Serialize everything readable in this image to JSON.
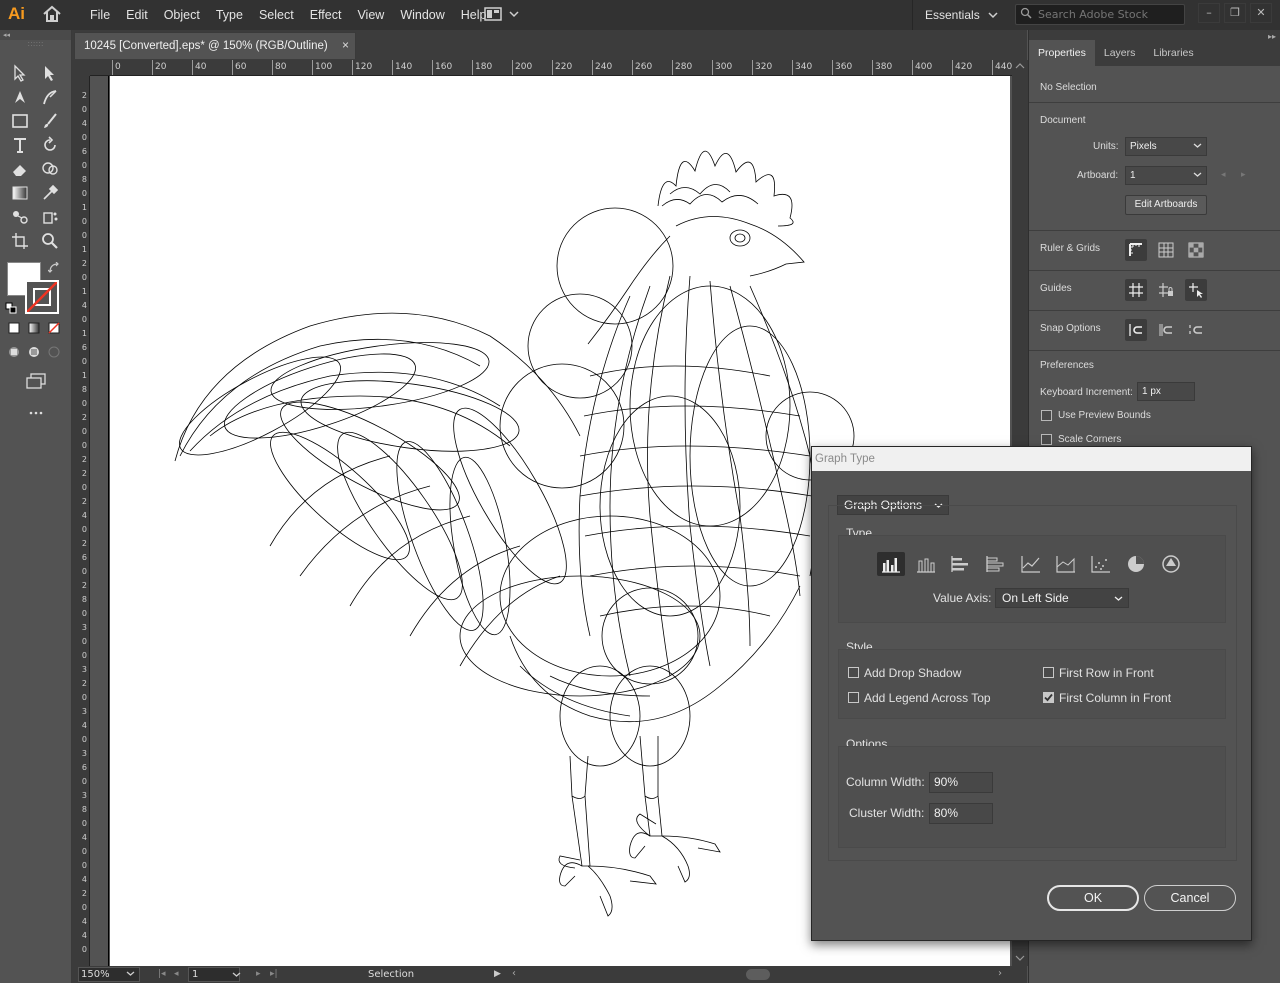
{
  "app": {
    "logo": "Ai",
    "workspace": "Essentials"
  },
  "menu": [
    "File",
    "Edit",
    "Object",
    "Type",
    "Select",
    "Effect",
    "View",
    "Window",
    "Help"
  ],
  "search": {
    "placeholder": "Search Adobe Stock"
  },
  "document": {
    "tab_title": "10245 [Converted].eps* @ 150% (RGB/Outline)",
    "close": "×"
  },
  "ruler": {
    "h_ticks": [
      "0",
      "20",
      "40",
      "60",
      "80",
      "100",
      "120",
      "140",
      "160",
      "180",
      "200",
      "220",
      "240",
      "260",
      "280",
      "300",
      "320",
      "340",
      "360",
      "380",
      "400",
      "420",
      "440"
    ],
    "v_ticks": [
      "2",
      "0",
      "4",
      "0",
      "6",
      "0",
      "8",
      "0",
      "1",
      "0",
      "0",
      "1",
      "2",
      "0",
      "1",
      "4",
      "0",
      "1",
      "6",
      "0",
      "1",
      "8",
      "0",
      "2",
      "0",
      "0",
      "2",
      "2",
      "0",
      "2",
      "4",
      "0",
      "2",
      "6",
      "0",
      "2",
      "8",
      "0",
      "3",
      "0",
      "0",
      "3",
      "2",
      "0",
      "3",
      "4",
      "0",
      "3",
      "6",
      "0",
      "3",
      "8",
      "0",
      "4",
      "0",
      "0",
      "4",
      "2",
      "0",
      "4",
      "4",
      "0"
    ]
  },
  "status": {
    "zoom": "150%",
    "page": "1",
    "tool": "Selection"
  },
  "panel": {
    "tabs": [
      "Properties",
      "Layers",
      "Libraries"
    ],
    "selection": "No Selection",
    "document_title": "Document",
    "units_label": "Units:",
    "units_value": "Pixels",
    "artboard_label": "Artboard:",
    "artboard_value": "1",
    "edit_artboards": "Edit Artboards",
    "ruler_grids": "Ruler & Grids",
    "guides": "Guides",
    "snap_options": "Snap Options",
    "preferences": "Preferences",
    "keyboard_increment_label": "Keyboard Increment:",
    "keyboard_increment_value": "1 px",
    "use_preview_bounds": "Use Preview Bounds",
    "scale_corners": "Scale Corners"
  },
  "dialog": {
    "title": "Graph Type",
    "mode_select": "Graph Options",
    "type_group": "Type",
    "graph_types": [
      "grouped-column",
      "stacked-column",
      "bar",
      "stacked-bar",
      "line",
      "area",
      "scatter",
      "pie",
      "radar"
    ],
    "active_graph_type": "grouped-column",
    "value_axis_label": "Value Axis:",
    "value_axis_value": "On Left Side",
    "style_group": "Style",
    "add_drop_shadow": "Add Drop Shadow",
    "add_legend_across_top": "Add Legend Across Top",
    "first_row_in_front": "First Row in Front",
    "first_column_in_front": "First Column in Front",
    "checks": {
      "add_drop_shadow": false,
      "add_legend_across_top": false,
      "first_row_in_front": false,
      "first_column_in_front": true
    },
    "options_group": "Options",
    "column_width_label": "Column Width:",
    "column_width_value": "90%",
    "cluster_width_label": "Cluster Width:",
    "cluster_width_value": "80%",
    "ok": "OK",
    "cancel": "Cancel"
  },
  "colors": {
    "accent": "#f79a1f",
    "chrome": "#323232",
    "panel": "#535353",
    "artboard": "#ffffff"
  }
}
